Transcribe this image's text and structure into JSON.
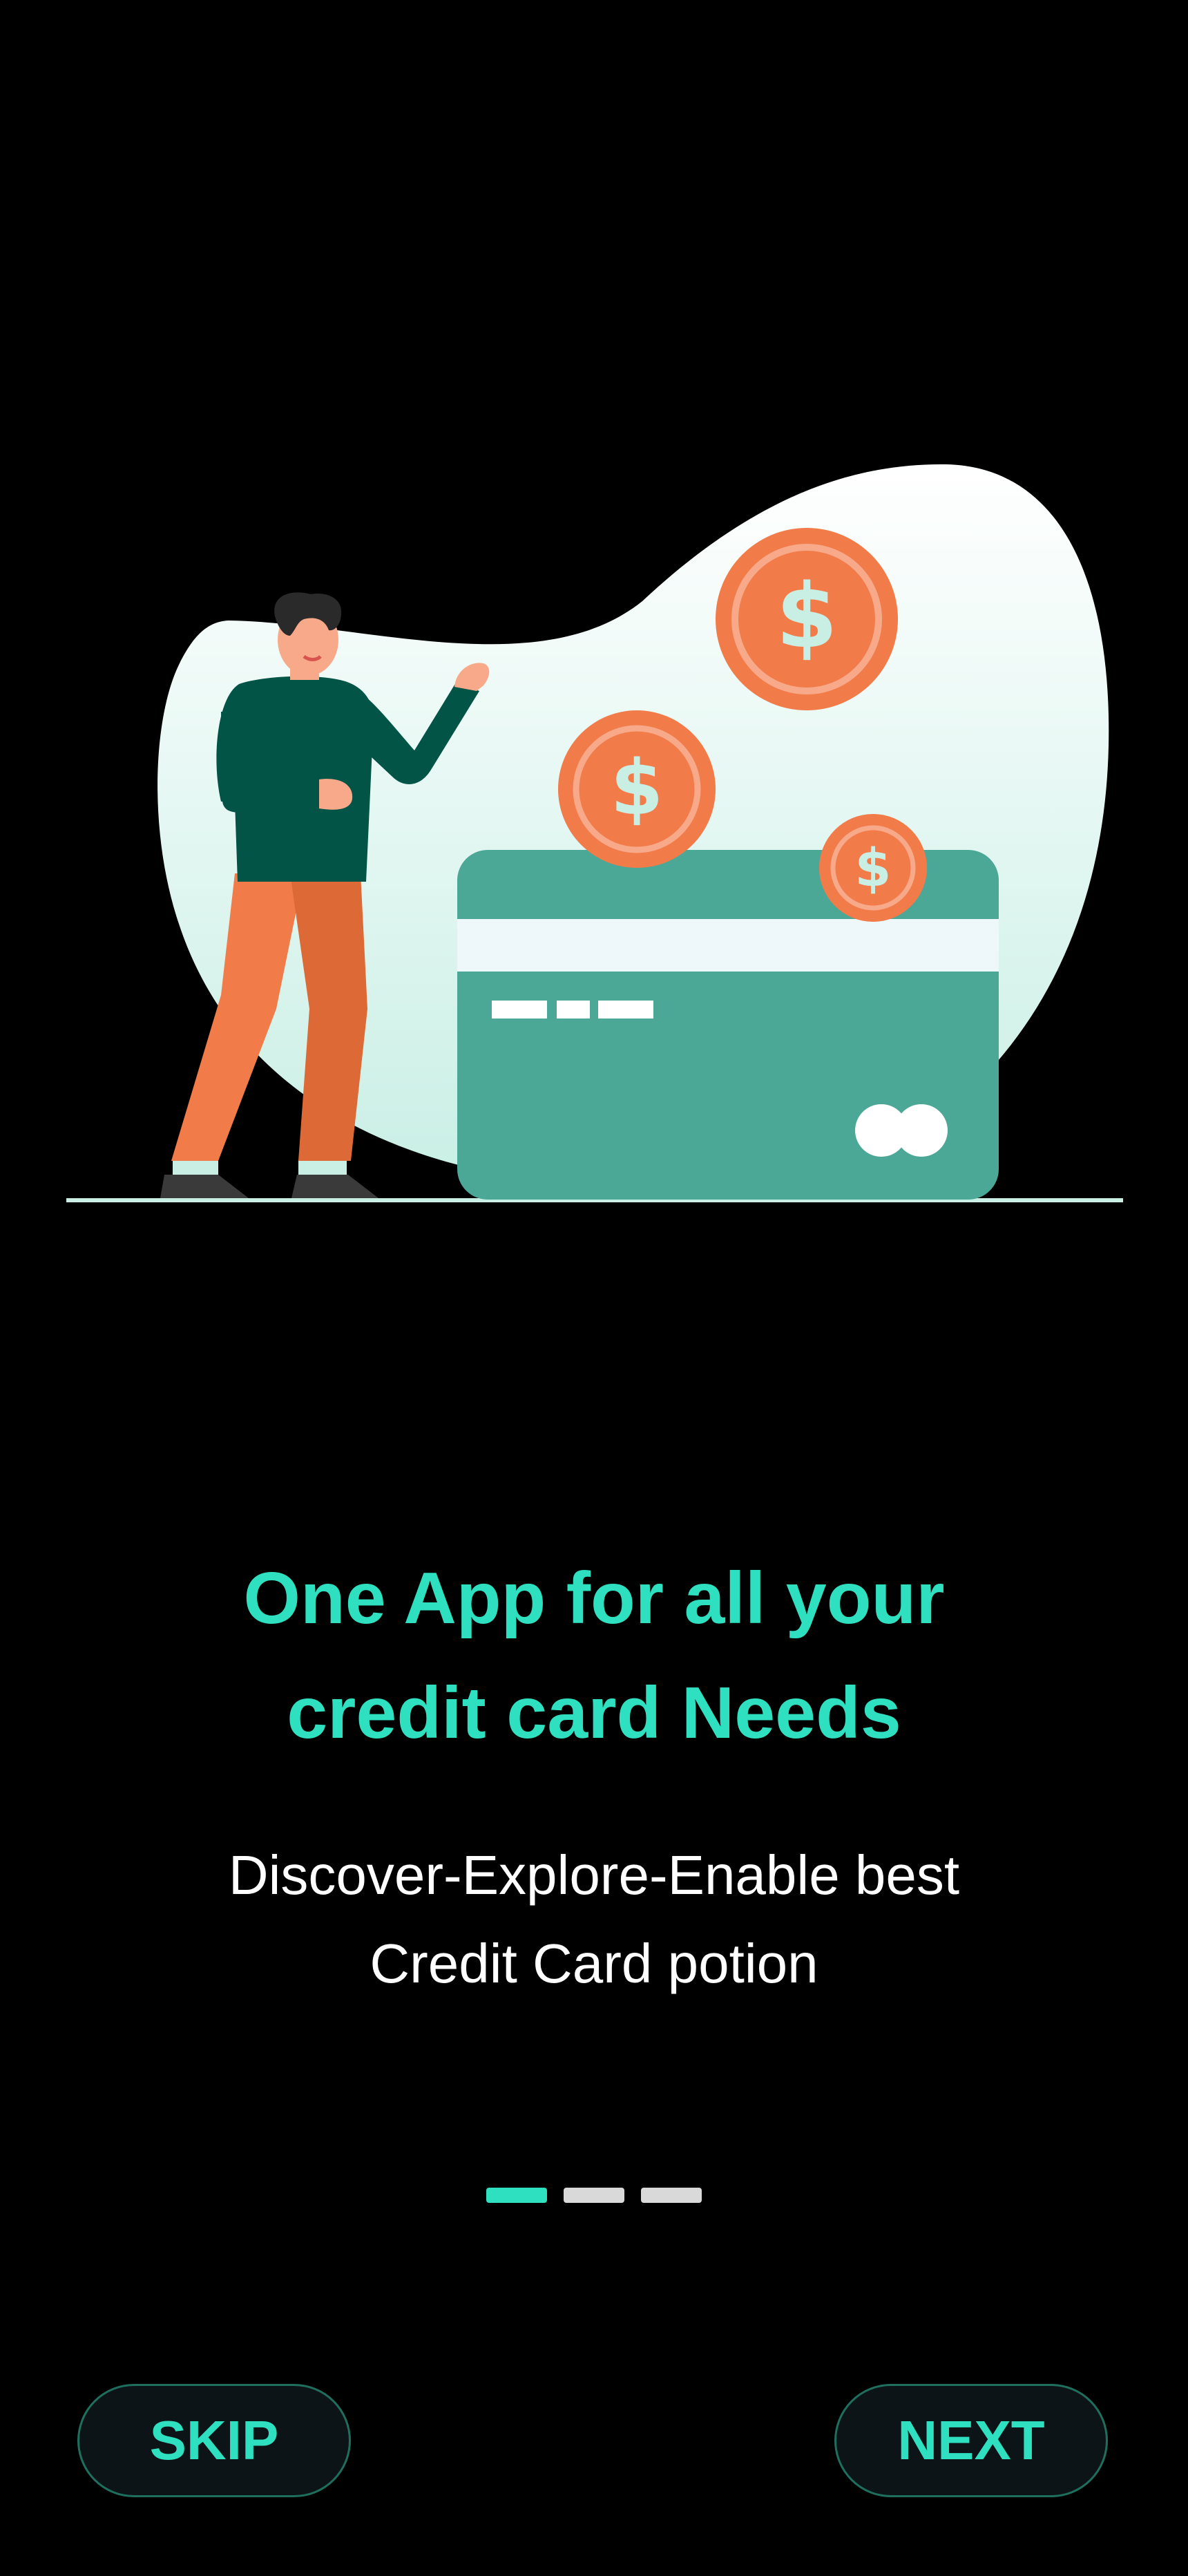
{
  "onboarding": {
    "headline_line1": "One App for all your",
    "headline_line2": "credit card Needs",
    "subtitle_line1": "Discover-Explore-Enable best",
    "subtitle_line2": "Credit Card potion",
    "pages_total": 3,
    "current_page": 1,
    "skip_label": "SKIP",
    "next_label": "NEXT"
  },
  "illustration": {
    "coin_symbol": "$",
    "icons": [
      "person-icon",
      "credit-card-icon",
      "coin-icon"
    ]
  },
  "colors": {
    "accent": "#2FE0C0",
    "background": "#000000",
    "card": "#4BA896",
    "coin": "#F27B4A",
    "button_bg": "#0D1418",
    "pager_inactive": "#D9D9D9"
  }
}
